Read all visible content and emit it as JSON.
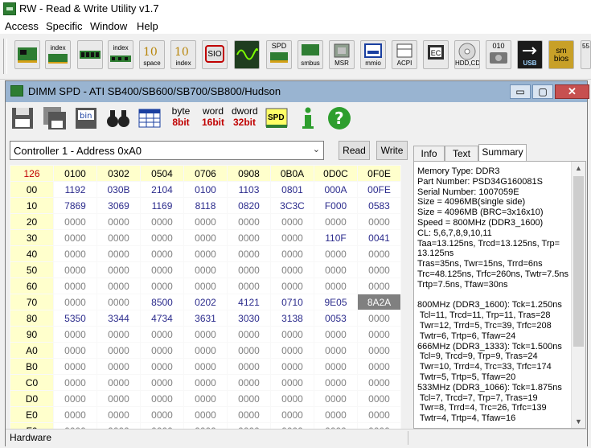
{
  "app": {
    "title": "RW - Read & Write Utility v1.7",
    "menu": [
      "Access",
      "Specific",
      "Window",
      "Help"
    ]
  },
  "toolbar": {
    "buttons": [
      {
        "name": "pci",
        "label": ""
      },
      {
        "name": "pci-index",
        "label": "index"
      },
      {
        "name": "memory",
        "label": ""
      },
      {
        "name": "memory-index",
        "label": "index"
      },
      {
        "name": "io-space",
        "label": "space"
      },
      {
        "name": "io-index",
        "label": "index"
      },
      {
        "name": "super-io",
        "label": "SIO"
      },
      {
        "name": "clock",
        "label": ""
      },
      {
        "name": "spd",
        "label": "SPD"
      },
      {
        "name": "smbus",
        "label": "smbus"
      },
      {
        "name": "msr",
        "label": "MSR"
      },
      {
        "name": "mmio",
        "label": "mmio"
      },
      {
        "name": "acpi",
        "label": "ACPI"
      },
      {
        "name": "ec",
        "label": "EC"
      },
      {
        "name": "hdd-cd",
        "label": "HDD,CD"
      },
      {
        "name": "hdd-info",
        "label": "010"
      },
      {
        "name": "usb",
        "label": "USB"
      },
      {
        "name": "smbios",
        "label": "sm bios"
      },
      {
        "name": "more",
        "label": "55"
      }
    ]
  },
  "child": {
    "title": "DIMM SPD - ATI SB400/SB600/SB700/SB800/Hudson",
    "win_minimize": "▭",
    "win_restore": "▢",
    "win_close": "✕",
    "toolbar_text": {
      "byte_top": "byte",
      "byte_bot": "8bit",
      "word_top": "word",
      "word_bot": "16bit",
      "dword_top": "dword",
      "dword_bot": "32bit",
      "spd": "SPD"
    },
    "controller": "Controller 1 - Address 0xA0",
    "read_label": "Read",
    "write_label": "Write",
    "tabs": [
      "Info",
      "Text",
      "Summary"
    ],
    "active_tab": "Summary",
    "status": "Hardware"
  },
  "grid": {
    "corner": "126",
    "columns": [
      "0100",
      "0302",
      "0504",
      "0706",
      "0908",
      "0B0A",
      "0D0C",
      "0F0E"
    ],
    "rows": [
      {
        "label": "00",
        "cells": [
          "1192",
          "030B",
          "2104",
          "0100",
          "1103",
          "0801",
          "000A",
          "00FE"
        ]
      },
      {
        "label": "10",
        "cells": [
          "7869",
          "3069",
          "1169",
          "8118",
          "0820",
          "3C3C",
          "F000",
          "0583"
        ]
      },
      {
        "label": "20",
        "cells": [
          "0000",
          "0000",
          "0000",
          "0000",
          "0000",
          "0000",
          "0000",
          "0000"
        ]
      },
      {
        "label": "30",
        "cells": [
          "0000",
          "0000",
          "0000",
          "0000",
          "0000",
          "0000",
          "110F",
          "0041"
        ]
      },
      {
        "label": "40",
        "cells": [
          "0000",
          "0000",
          "0000",
          "0000",
          "0000",
          "0000",
          "0000",
          "0000"
        ]
      },
      {
        "label": "50",
        "cells": [
          "0000",
          "0000",
          "0000",
          "0000",
          "0000",
          "0000",
          "0000",
          "0000"
        ]
      },
      {
        "label": "60",
        "cells": [
          "0000",
          "0000",
          "0000",
          "0000",
          "0000",
          "0000",
          "0000",
          "0000"
        ]
      },
      {
        "label": "70",
        "cells": [
          "0000",
          "0000",
          "8500",
          "0202",
          "4121",
          "0710",
          "9E05",
          "8A2A"
        ]
      },
      {
        "label": "80",
        "cells": [
          "5350",
          "3344",
          "4734",
          "3631",
          "3030",
          "3138",
          "0053",
          "0000"
        ]
      },
      {
        "label": "90",
        "cells": [
          "0000",
          "0000",
          "0000",
          "0000",
          "0000",
          "0000",
          "0000",
          "0000"
        ]
      },
      {
        "label": "A0",
        "cells": [
          "0000",
          "0000",
          "0000",
          "0000",
          "0000",
          "0000",
          "0000",
          "0000"
        ]
      },
      {
        "label": "B0",
        "cells": [
          "0000",
          "0000",
          "0000",
          "0000",
          "0000",
          "0000",
          "0000",
          "0000"
        ]
      },
      {
        "label": "C0",
        "cells": [
          "0000",
          "0000",
          "0000",
          "0000",
          "0000",
          "0000",
          "0000",
          "0000"
        ]
      },
      {
        "label": "D0",
        "cells": [
          "0000",
          "0000",
          "0000",
          "0000",
          "0000",
          "0000",
          "0000",
          "0000"
        ]
      },
      {
        "label": "E0",
        "cells": [
          "0000",
          "0000",
          "0000",
          "0000",
          "0000",
          "0000",
          "0000",
          "0000"
        ]
      },
      {
        "label": "F0",
        "cells": [
          "0000",
          "0000",
          "0000",
          "0000",
          "0000",
          "0000",
          "0000",
          "0000"
        ]
      }
    ],
    "selected": {
      "row": "70",
      "col": "0F0E"
    },
    "colors": {
      "header_bg": "#ffffcc",
      "corner": "#c00000",
      "nonzero": "#2b2b8c",
      "zero": "#808080",
      "selected_bg": "#808080"
    }
  },
  "summary": {
    "lines": [
      "Memory Type: DDR3",
      "Part Number: PSD34G160081S",
      "Serial Number: 1007059E",
      "Size = 4096MB(single side)",
      "Size = 4096MB (BRC=3x16x10)",
      "Speed = 800MHz (DDR3_1600)",
      "CL: 5,6,7,8,9,10,11",
      "Taa=13.125ns, Trcd=13.125ns, Trp=",
      "13.125ns",
      "Tras=35ns, Twr=15ns, Trrd=6ns",
      "Trc=48.125ns, Trfc=260ns, Twtr=7.5ns",
      "Trtp=7.5ns, Tfaw=30ns",
      "",
      "800MHz (DDR3_1600): Tck=1.250ns",
      " Tcl=11, Trcd=11, Trp=11, Tras=28",
      " Twr=12, Trrd=5, Trc=39, Trfc=208",
      " Twtr=6, Trtp=6, Tfaw=24",
      "666MHz (DDR3_1333): Tck=1.500ns",
      " Tcl=9, Trcd=9, Trp=9, Tras=24",
      " Twr=10, Trrd=4, Trc=33, Trfc=174",
      " Twtr=5, Trtp=5, Tfaw=20",
      "533MHz (DDR3_1066): Tck=1.875ns",
      " Tcl=7, Trcd=7, Trp=7, Tras=19",
      " Twr=8, Trrd=4, Trc=26, Trfc=139",
      " Twtr=4, Trtp=4, Tfaw=16"
    ]
  }
}
